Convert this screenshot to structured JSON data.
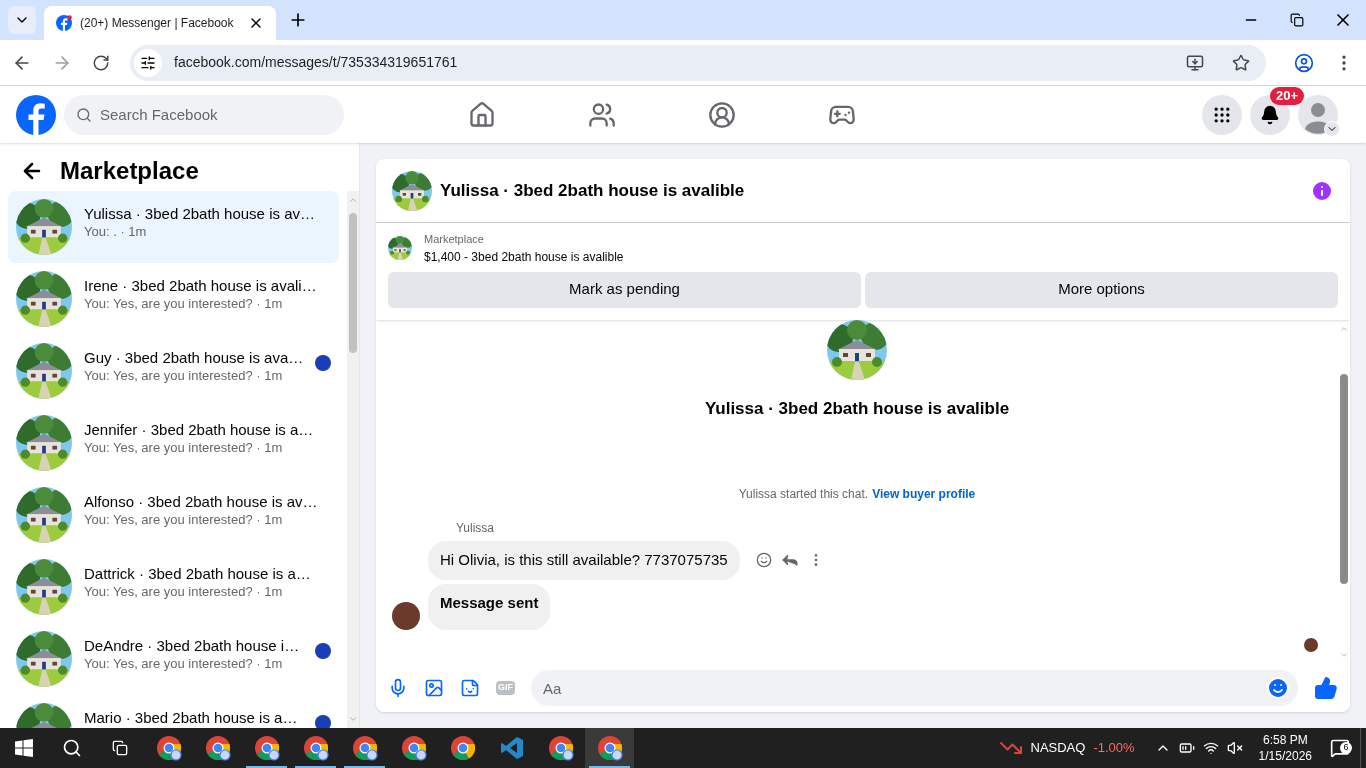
{
  "browser": {
    "tab_title": "(20+) Messenger | Facebook",
    "url": "facebook.com/messages/t/735334319651761"
  },
  "header": {
    "search_placeholder": "Search Facebook",
    "nav": [
      {
        "kind": "home"
      },
      {
        "kind": "friends"
      },
      {
        "kind": "groups"
      },
      {
        "kind": "gaming"
      }
    ],
    "notification_badge": "20+"
  },
  "sidebar": {
    "title": "Marketplace",
    "conversations": [
      {
        "title": "Yulissa · 3bed 2bath house is av…",
        "preview": "You: . · 1m",
        "selected": true,
        "seen_marker": false
      },
      {
        "title": "Irene · 3bed 2bath house is avali…",
        "preview": "You: Yes, are you interested? · 1m",
        "selected": false,
        "seen_marker": false
      },
      {
        "title": "Guy · 3bed 2bath house is ava…",
        "preview": "You: Yes, are you interested? · 1m",
        "selected": false,
        "seen_marker": true
      },
      {
        "title": "Jennifer · 3bed 2bath house is a…",
        "preview": "You: Yes, are you interested? · 1m",
        "selected": false,
        "seen_marker": false
      },
      {
        "title": "Alfonso · 3bed 2bath house is av…",
        "preview": "You: Yes, are you interested? · 1m",
        "selected": false,
        "seen_marker": false
      },
      {
        "title": "Dattrick · 3bed 2bath house is a…",
        "preview": "You: Yes, are you interested? · 1m",
        "selected": false,
        "seen_marker": false
      },
      {
        "title": "DeAndre · 3bed 2bath house i…",
        "preview": "You: Yes, are you interested? · 1m",
        "selected": false,
        "seen_marker": true
      },
      {
        "title": "Mario · 3bed 2bath house is a…",
        "selected": false,
        "seen_marker": true
      }
    ]
  },
  "chat": {
    "title": "Yulissa · 3bed 2bath house is avalible",
    "listing": {
      "label": "Marketplace",
      "text": "$1,400 - 3bed 2bath house is avalible"
    },
    "actions": [
      "Mark as pending",
      "More options"
    ],
    "intro_title": "Yulissa · 3bed 2bath house is avalible",
    "started_text": "Yulissa started this chat.",
    "profile_link": "View buyer profile",
    "messages": [
      {
        "sender": "Yulissa",
        "text": "Hi Olivia, is this still available? 7737075735",
        "bold": false,
        "show_actions": true,
        "show_avatar": false
      },
      {
        "text": "Message sent",
        "bold": true,
        "show_actions": false,
        "show_avatar": true
      }
    ],
    "composer": {
      "placeholder": "Aa",
      "gif_label": "GIF"
    }
  },
  "taskbar": {
    "apps": [
      {
        "kind": "chrome-profile",
        "running": false,
        "active": false
      },
      {
        "kind": "chrome-profile",
        "running": false,
        "active": false
      },
      {
        "kind": "chrome-profile",
        "running": true,
        "active": false
      },
      {
        "kind": "chrome-profile",
        "running": true,
        "active": false
      },
      {
        "kind": "chrome-profile",
        "running": true,
        "active": false
      },
      {
        "kind": "chrome-profile",
        "running": false,
        "active": false
      },
      {
        "kind": "chrome",
        "running": false,
        "active": false
      },
      {
        "kind": "vscode",
        "running": false,
        "active": false
      },
      {
        "kind": "chrome-profile",
        "running": false,
        "active": false
      },
      {
        "kind": "chrome-profile",
        "running": true,
        "active": true
      }
    ],
    "ticker": {
      "name": "NASDAQ",
      "change": "-1.00%"
    },
    "time": "6:58 PM",
    "date": "1/15/2026",
    "notifications": "6"
  }
}
